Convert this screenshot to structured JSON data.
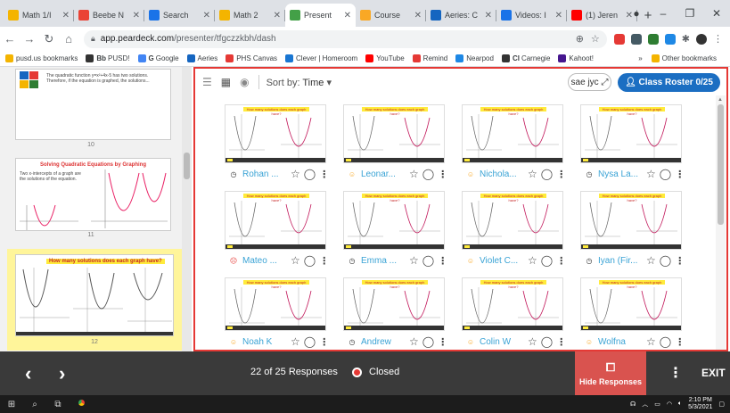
{
  "browser": {
    "tabs": [
      {
        "title": "Math 1/I",
        "color": "#f4b400"
      },
      {
        "title": "Beebe N",
        "color": "#ea4335"
      },
      {
        "title": "Search",
        "color": "#1a73e8"
      },
      {
        "title": "Math 2",
        "color": "#f4b400"
      },
      {
        "title": "Present",
        "color": "#43a047",
        "active": true
      },
      {
        "title": "Course",
        "color": "#f9a825"
      },
      {
        "title": "Aeries: C",
        "color": "#1565c0"
      },
      {
        "title": "Videos: I",
        "color": "#1a73e8"
      },
      {
        "title": "(1) Jeren",
        "color": "#ff0000"
      }
    ],
    "url_host": "app.peardeck.com",
    "url_path": "/presenter/tfgczzkbh/dash",
    "bookmarks": [
      {
        "label": "pusd.us bookmarks",
        "color": "#f4b400"
      },
      {
        "label": "PUSD!",
        "color": "#333333",
        "prefix": "Bb"
      },
      {
        "label": "Google",
        "color": "#4285f4",
        "prefix": "G"
      },
      {
        "label": "Aeries",
        "color": "#1565c0"
      },
      {
        "label": "PHS Canvas",
        "color": "#e53935"
      },
      {
        "label": "Clever | Homeroom",
        "color": "#1976d2"
      },
      {
        "label": "YouTube",
        "color": "#ff0000"
      },
      {
        "label": "Remind",
        "color": "#e53935"
      },
      {
        "label": "Nearpod",
        "color": "#1e88e5"
      },
      {
        "label": "Carnegie",
        "color": "#333333",
        "prefix": "Cl"
      },
      {
        "label": "Kahoot!",
        "color": "#46178f"
      }
    ],
    "bookmarks_more": "»",
    "other_bookmarks": "Other bookmarks"
  },
  "sidebar": {
    "slides": [
      {
        "number": "10",
        "title": "",
        "text": "The quadratic function y=x²+4x-5 has two solutions. Therefore, if the equation is graphed, the solutions..."
      },
      {
        "number": "11",
        "title": "Solving Quadratic Equations by Graphing",
        "text": "Two x-intercepts of a graph are the solutions of the equation."
      },
      {
        "number": "12",
        "title": "How many solutions does each graph have?",
        "text": ""
      }
    ]
  },
  "toolbar": {
    "sort_label": "Sort by:",
    "sort_value": "Time",
    "code": "sae jyc",
    "roster_label": "Class Roster 0/25"
  },
  "question_title": "How many solutions does each graph have?",
  "students": [
    {
      "name": "Rohan ...",
      "status": "clock"
    },
    {
      "name": "Leonar...",
      "status": "smile"
    },
    {
      "name": "Nichola...",
      "status": "smile"
    },
    {
      "name": "Nysa La...",
      "status": "clock"
    },
    {
      "name": "Mateo ...",
      "status": "sad"
    },
    {
      "name": "Emma ...",
      "status": "clock"
    },
    {
      "name": "Violet C...",
      "status": "smile"
    },
    {
      "name": "Iyan (Fir...",
      "status": "clock"
    },
    {
      "name": "Noah K",
      "status": "smile"
    },
    {
      "name": "Andrew",
      "status": "clock"
    },
    {
      "name": "Colin W",
      "status": "smile"
    },
    {
      "name": "Wolfna",
      "status": "smile"
    }
  ],
  "footer": {
    "responses": "22 of 25 Responses",
    "status": "Closed",
    "hide_label": "Hide Responses",
    "exit_label": "EXIT"
  },
  "taskbar": {
    "time": "2:10 PM",
    "date": "5/3/2021"
  },
  "colors": {
    "accent_red": "#e53935",
    "roster_blue": "#1b6ec2",
    "student_name": "#3aa3d5",
    "selected_slide": "#fff59a"
  }
}
